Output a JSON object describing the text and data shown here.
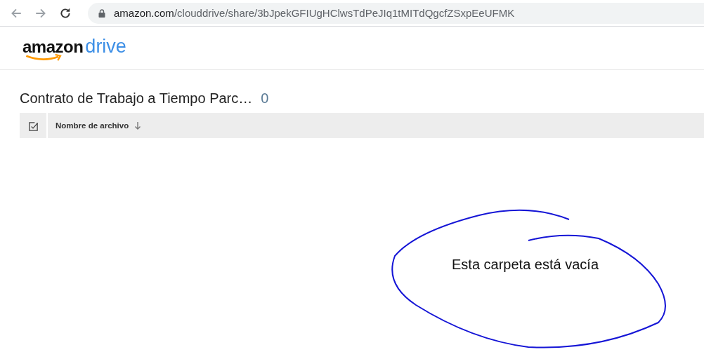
{
  "browser": {
    "url_host": "amazon.com",
    "url_path": "/clouddrive/share/3bJpekGFIUgHClwsTdPeJIq1tMITdQgcfZSxpEeUFMK"
  },
  "logo": {
    "brand": "amazon",
    "product": "drive"
  },
  "folder": {
    "title": "Contrato de Trabajo a Tiempo Parc…",
    "count": "0"
  },
  "table": {
    "select_all": {
      "checked": true
    },
    "columns": [
      {
        "label": "Nombre de archivo",
        "sorted": true
      }
    ]
  },
  "empty_message": "Esta carpeta está vacía"
}
